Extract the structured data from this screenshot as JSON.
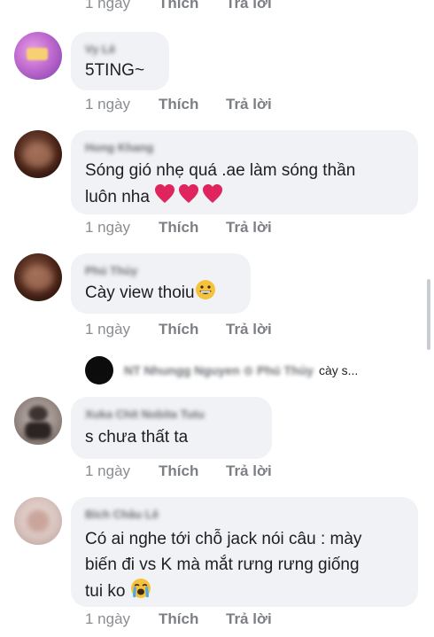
{
  "actions": {
    "time": "1 ngày",
    "like": "Thích",
    "reply": "Trả lời"
  },
  "comments": [
    {
      "name": "Vy Lê",
      "text": "5TING~"
    },
    {
      "name": "Hong Khang",
      "text_line1": "Sóng gió nhẹ quá .ae làm sóng thần",
      "text_line2": "luôn nha",
      "emoji": "heart-emoji x3"
    },
    {
      "name": "Phú Thủy",
      "text": "Cày view thoiu",
      "emoji": "grinning-emoji"
    },
    {
      "name": "Xuka Chit Nobita Tutu",
      "text": "s chưa thất ta"
    },
    {
      "name": "Bích Châu Lê",
      "text_line1": "Có ai nghe tới chỗ jack nói câu : mày",
      "text_line2": "biến đi vs K mà mắt rưng rưng giống",
      "text_line3": "tui ko",
      "emoji": "crying-emoji"
    }
  ],
  "reply_preview": {
    "name": "NT Nhungg Nguyen ⊙ Phú Thủy",
    "snippet": "cày s..."
  },
  "colors": {
    "bubble": "#f0f2f5",
    "meta": "#8a8d91",
    "heart": "#e0245e",
    "emoji_yellow": "#f7c23b"
  }
}
